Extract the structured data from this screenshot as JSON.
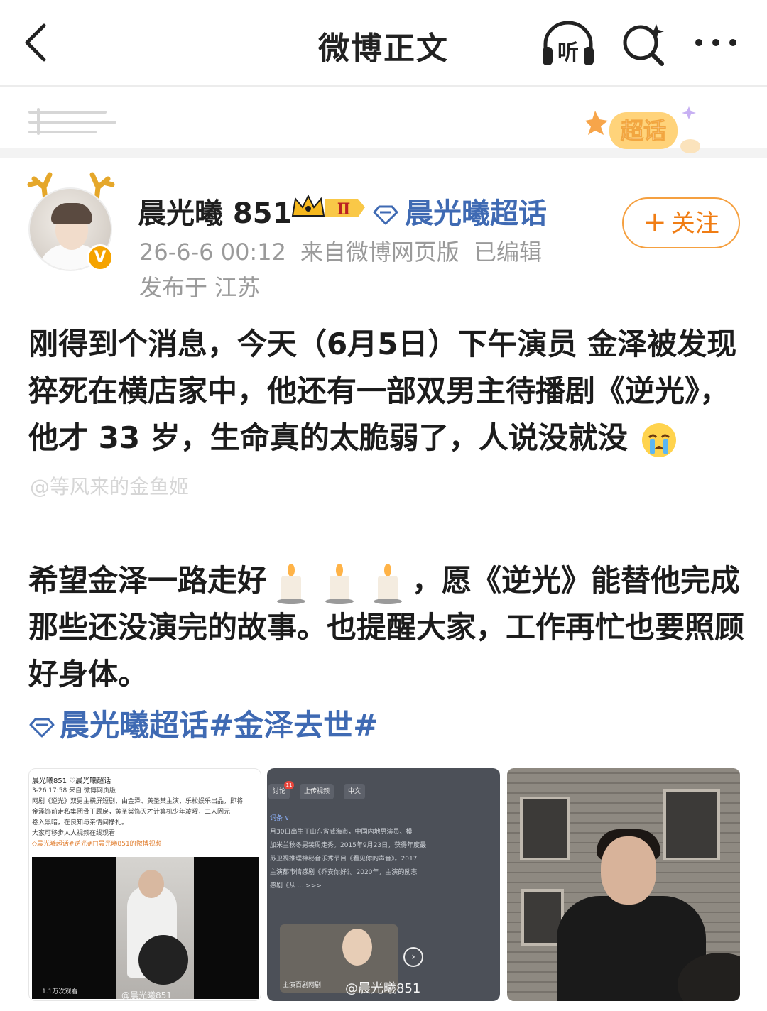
{
  "nav": {
    "title": "微博正文",
    "listen_label": "听"
  },
  "supertopic_badge": "超话",
  "post": {
    "username": "晨光曦 851",
    "level_badge": "Ⅱ",
    "topic": "晨光曦超话",
    "time": "26-6-6 00:12",
    "source": "来自微博网页版",
    "edited": "已编辑",
    "location": "发布于 江苏",
    "follow_label": "关注",
    "paragraph1": "刚得到个消息，今天（6月5日）下午演员 金泽被发现猝死在横店家中，他还有一部双男主待播剧《逆光》，他才 33 岁，生命真的太脆弱了，人说没就没",
    "watermark": "@等风来的金鱼姬",
    "paragraph2_part1": "希望金泽一路走好",
    "paragraph2_part2": "，愿《逆光》能替他完成那些还没演完的故事。也提醒大家，工作再忙也要照顾好身体。",
    "hashtags": "晨光曦超话#金泽去世#"
  },
  "images": {
    "img1": {
      "header": "晨光曦851 ♡晨光曦超话",
      "lines": [
        "3-26 17:58 来自 微博网页版",
        "网剧《逆光》双男主横屏短剧，由金泽、黄圣棠主演，乐松娱乐出品，即将",
        "金泽饰前走私集团骨干顾戾，黄圣棠饰天才计算机少年凌曜，二人因元",
        "卷入黑暗，在良知与亲情间挣扎。",
        "大家可移步人人视频在线观看",
        "◇晨光曦超话#逆光#□晨光曦851的微博视频"
      ],
      "view_count": "1.1万次观看",
      "watermark": "@晨光曦851"
    },
    "img2": {
      "chips": [
        "讨论",
        "上传视频",
        "中文"
      ],
      "badge": "11",
      "label": "词条 ∨",
      "lines": [
        "月30日出生于山东省威海市，中国内地男演员、模",
        "加米兰秋冬男装周走秀。2015年9月23日，获得年度最",
        "苏卫视推理神秘音乐秀节目《看见你的声音》。2017",
        "主演都市情感剧《乔安你好》。2020年，主演的励志",
        "感剧《从 ... >>>"
      ],
      "caption": "主演百剧网剧",
      "watermark": "@晨光曦851"
    }
  },
  "colors": {
    "link": "#3f6ab3",
    "follow": "#f07d14",
    "meta": "#9a9a9a"
  }
}
